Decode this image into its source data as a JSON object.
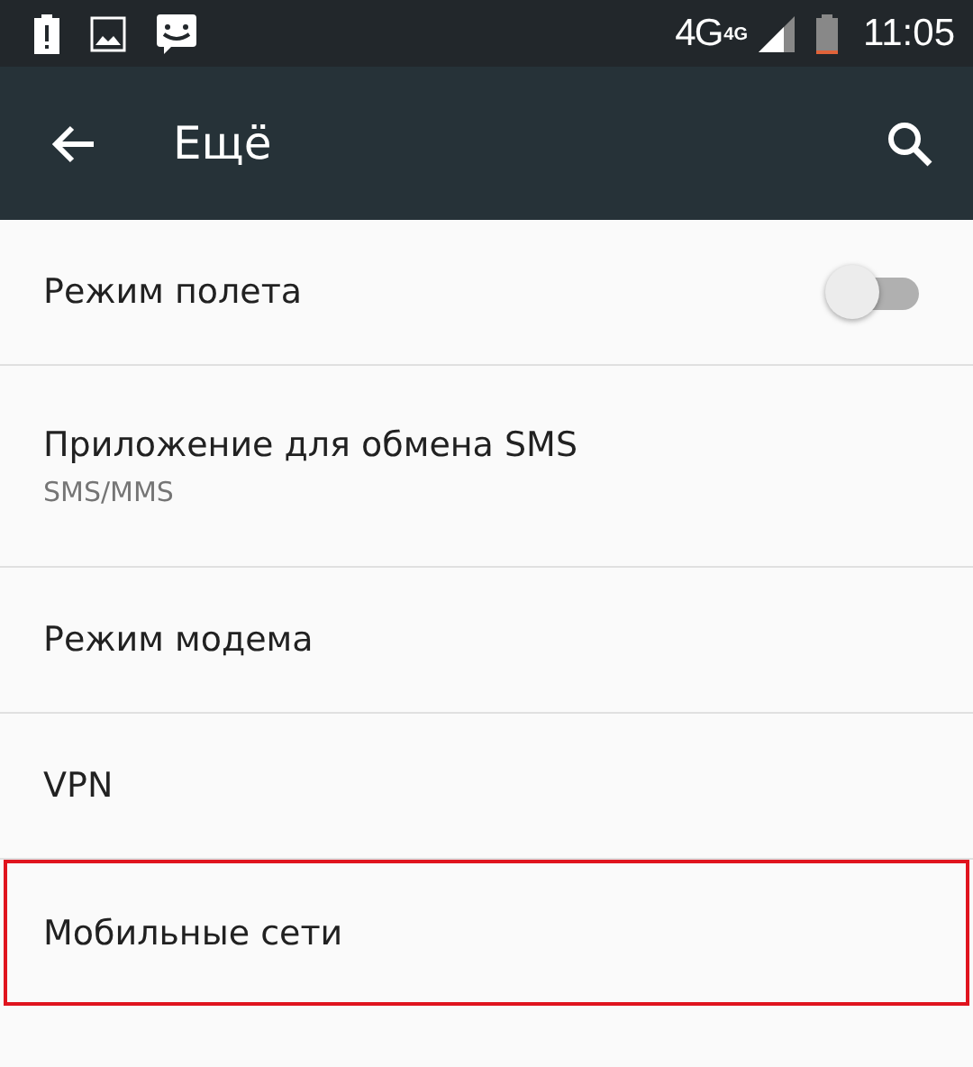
{
  "status_bar": {
    "network": "4G",
    "network_badge": "4G",
    "time": "11:05"
  },
  "toolbar": {
    "title": "Ещё"
  },
  "items": [
    {
      "kind": "switch",
      "title": "Режим полета",
      "on": false,
      "highlighted": false
    },
    {
      "kind": "text",
      "title": "Приложение для обмена SMS",
      "summary": "SMS/MMS",
      "highlighted": false
    },
    {
      "kind": "text",
      "title": "Режим модема",
      "highlighted": false
    },
    {
      "kind": "text",
      "title": "VPN",
      "highlighted": false
    },
    {
      "kind": "text",
      "title": "Мобильные сети",
      "highlighted": true
    }
  ]
}
